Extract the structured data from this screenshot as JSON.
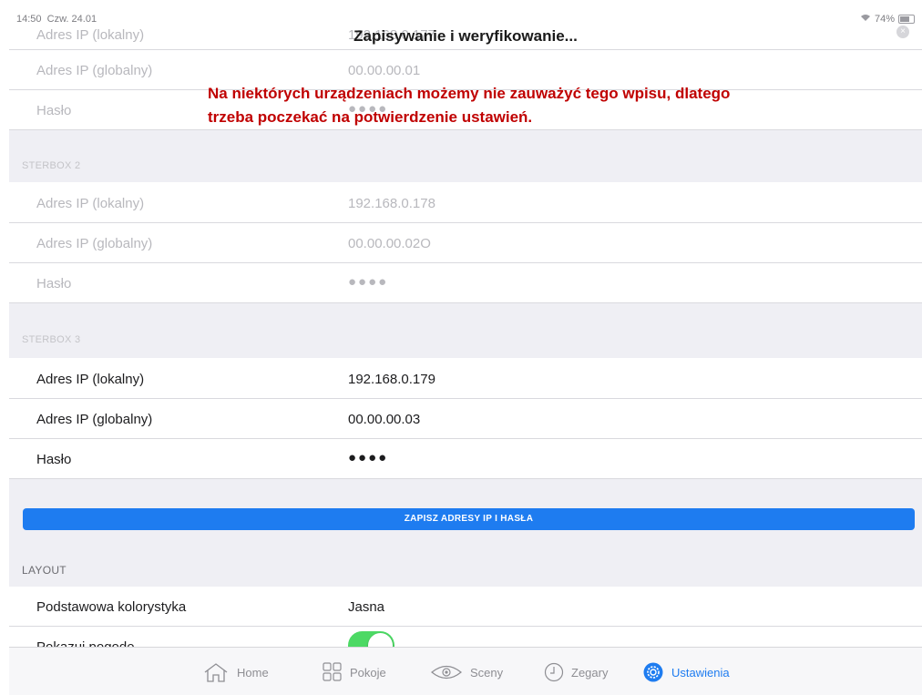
{
  "status_bar": {
    "time": "14:50",
    "date": "Czw. 24.01",
    "battery": "74%"
  },
  "dialog": {
    "title": "Zapisywanie i weryfikowanie..."
  },
  "annotation": {
    "text": "Na niektórych urządzeniach możemy nie zauważyć tego wpisu, dlatego trzeba poczekać na potwierdzenie ustawień."
  },
  "sterbox1": {
    "local_label": "Adres IP (lokalny)",
    "local_value": "192.168.0.177",
    "global_label": "Adres IP (globalny)",
    "global_value": "00.00.00.01",
    "password_label": "Hasło",
    "password_value": "●●●●"
  },
  "sterbox2": {
    "header": "STERBOX 2",
    "local_label": "Adres IP (lokalny)",
    "local_value": "192.168.0.178",
    "global_label": "Adres IP (globalny)",
    "global_value": "00.00.00.02O",
    "password_label": "Hasło",
    "password_value": "●●●●"
  },
  "sterbox3": {
    "header": "STERBOX 3",
    "local_label": "Adres IP (lokalny)",
    "local_value": "192.168.0.179",
    "global_label": "Adres IP (globalny)",
    "global_value": "00.00.00.03",
    "password_label": "Hasło",
    "password_value": "●●●●"
  },
  "save_button": {
    "label": "ZAPISZ ADRESY IP I HASŁA"
  },
  "layout": {
    "header": "LAYOUT",
    "color_label": "Podstawowa kolorystyka",
    "color_value": "Jasna",
    "weather_label": "Pokazuj pogodę",
    "weather_on": true
  },
  "tabbar": {
    "items": [
      {
        "label": "Home",
        "icon": "home-icon"
      },
      {
        "label": "Pokoje",
        "icon": "grid-icon"
      },
      {
        "label": "Sceny",
        "icon": "eye-icon"
      },
      {
        "label": "Zegary",
        "icon": "clock-icon"
      },
      {
        "label": "Ustawienia",
        "icon": "gear-icon",
        "active": true
      }
    ]
  },
  "colors": {
    "accent": "#1e7cf0",
    "toggle_on": "#4cd964",
    "annotation": "#c00000"
  }
}
